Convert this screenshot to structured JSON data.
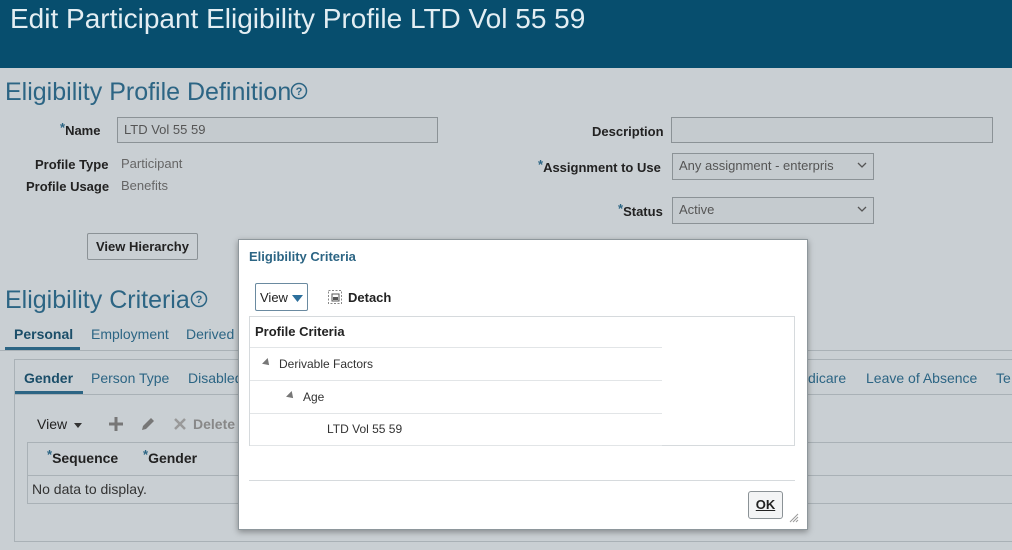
{
  "header": {
    "title": "Edit Participant Eligibility Profile LTD Vol 55 59"
  },
  "definition": {
    "section_title": "Eligibility Profile Definition",
    "name_label": "Name",
    "name_value": "LTD Vol 55 59",
    "profile_type_label": "Profile Type",
    "profile_type_value": "Participant",
    "profile_usage_label": "Profile Usage",
    "profile_usage_value": "Benefits",
    "description_label": "Description",
    "description_value": "",
    "assignment_label": "Assignment to Use",
    "assignment_value": "Any assignment - enterpris",
    "status_label": "Status",
    "status_value": "Active",
    "view_hierarchy_label": "View Hierarchy"
  },
  "criteria": {
    "section_title": "Eligibility Criteria",
    "tabs": [
      "Personal",
      "Employment",
      "Derived"
    ],
    "subtabs": [
      "Gender",
      "Person Type",
      "Disabled"
    ],
    "right_subtabs": [
      "dicare",
      "Leave of Absence",
      "Te"
    ],
    "toolbar": {
      "view": "View",
      "delete": "Delete"
    },
    "columns": [
      "Sequence",
      "Gender"
    ],
    "empty_text": "No data to display."
  },
  "dialog": {
    "title": "Eligibility Criteria",
    "view_label": "View",
    "detach_label": "Detach",
    "tree_header": "Profile Criteria",
    "tree": [
      {
        "label": "Derivable Factors",
        "level": 0,
        "expanded": true
      },
      {
        "label": "Age",
        "level": 1,
        "expanded": true
      },
      {
        "label": "LTD Vol 55 59",
        "level": 2,
        "expanded": false
      }
    ],
    "ok_label": "OK"
  }
}
